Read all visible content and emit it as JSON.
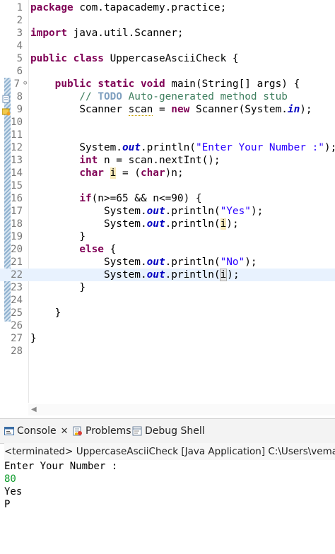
{
  "editor": {
    "lines": [
      {
        "n": "1"
      },
      {
        "n": "2"
      },
      {
        "n": "3"
      },
      {
        "n": "4"
      },
      {
        "n": "5"
      },
      {
        "n": "6"
      },
      {
        "n": "7"
      },
      {
        "n": "8"
      },
      {
        "n": "9"
      },
      {
        "n": "10"
      },
      {
        "n": "11"
      },
      {
        "n": "12"
      },
      {
        "n": "13"
      },
      {
        "n": "14"
      },
      {
        "n": "15"
      },
      {
        "n": "16"
      },
      {
        "n": "17"
      },
      {
        "n": "18"
      },
      {
        "n": "19"
      },
      {
        "n": "20"
      },
      {
        "n": "21"
      },
      {
        "n": "22"
      },
      {
        "n": "23"
      },
      {
        "n": "24"
      },
      {
        "n": "25"
      },
      {
        "n": "26"
      },
      {
        "n": "27"
      },
      {
        "n": "28"
      }
    ],
    "t": {
      "package": "package",
      "pkg_name": " com.tapacademy.practice;",
      "import": "import",
      "import_name": " java.util.Scanner;",
      "public": "public",
      "class": "class",
      "class_name": " UppercaseAsciiCheck {",
      "static": "static",
      "void": "void",
      "main_sig": " main(String[] args) {",
      "cmt_slashes": "// ",
      "todo": "TODO",
      "cmt_rest": " Auto-generated method stub",
      "scanner_decl": "Scanner ",
      "scan": "scan",
      "eq": " = ",
      "new": "new",
      "scanner_ctor": " Scanner(System.",
      "in": "in",
      "close_paren_semi": ");",
      "system": "System.",
      "out": "out",
      "println_open": ".println(",
      "enter_str": "\"Enter Your Number :\"",
      "int": "int",
      "int_rest": " n = scan.nextInt();",
      "char": "char",
      "char_i": "i",
      "char_assign": " = (",
      "char_cast_rest": ")n;",
      "if_kw": "if",
      "if_cond": "(n>=65 && n<=90) {",
      "yes_str": "\"Yes\"",
      "i_var": "i",
      "close_brace": "}",
      "else_kw": "else",
      "open_brace": " {",
      "no_str": "\"No\"",
      "i_var2": "i",
      "close_paren_semi2": ");",
      "close_brace2": "}",
      "close_brace3": "}",
      "close_brace4": "}",
      "close_brace5": "}"
    },
    "fold_glyph": "⊖",
    "current_line": 22
  },
  "console": {
    "tabs": [
      {
        "label": "Console",
        "close": "✕"
      },
      {
        "label": "Problems"
      },
      {
        "label": "Debug Shell"
      }
    ],
    "terminated_line": "<terminated> UppercaseAsciiCheck [Java Application] C:\\Users\\vemal\\AppData",
    "output": [
      "Enter Your Number :",
      "80",
      "Yes",
      "P"
    ]
  },
  "colors": {
    "keyword": "#7f0055",
    "string": "#2a00ff",
    "comment": "#3f7f5f",
    "field": "#0000c0",
    "user_input": "#0a9a28"
  },
  "icons": [
    "fold-collapse-icon",
    "override-marker-icon",
    "warning-marker-icon",
    "console-icon",
    "problems-icon",
    "debug-shell-icon",
    "close-icon",
    "scroll-left-icon"
  ]
}
